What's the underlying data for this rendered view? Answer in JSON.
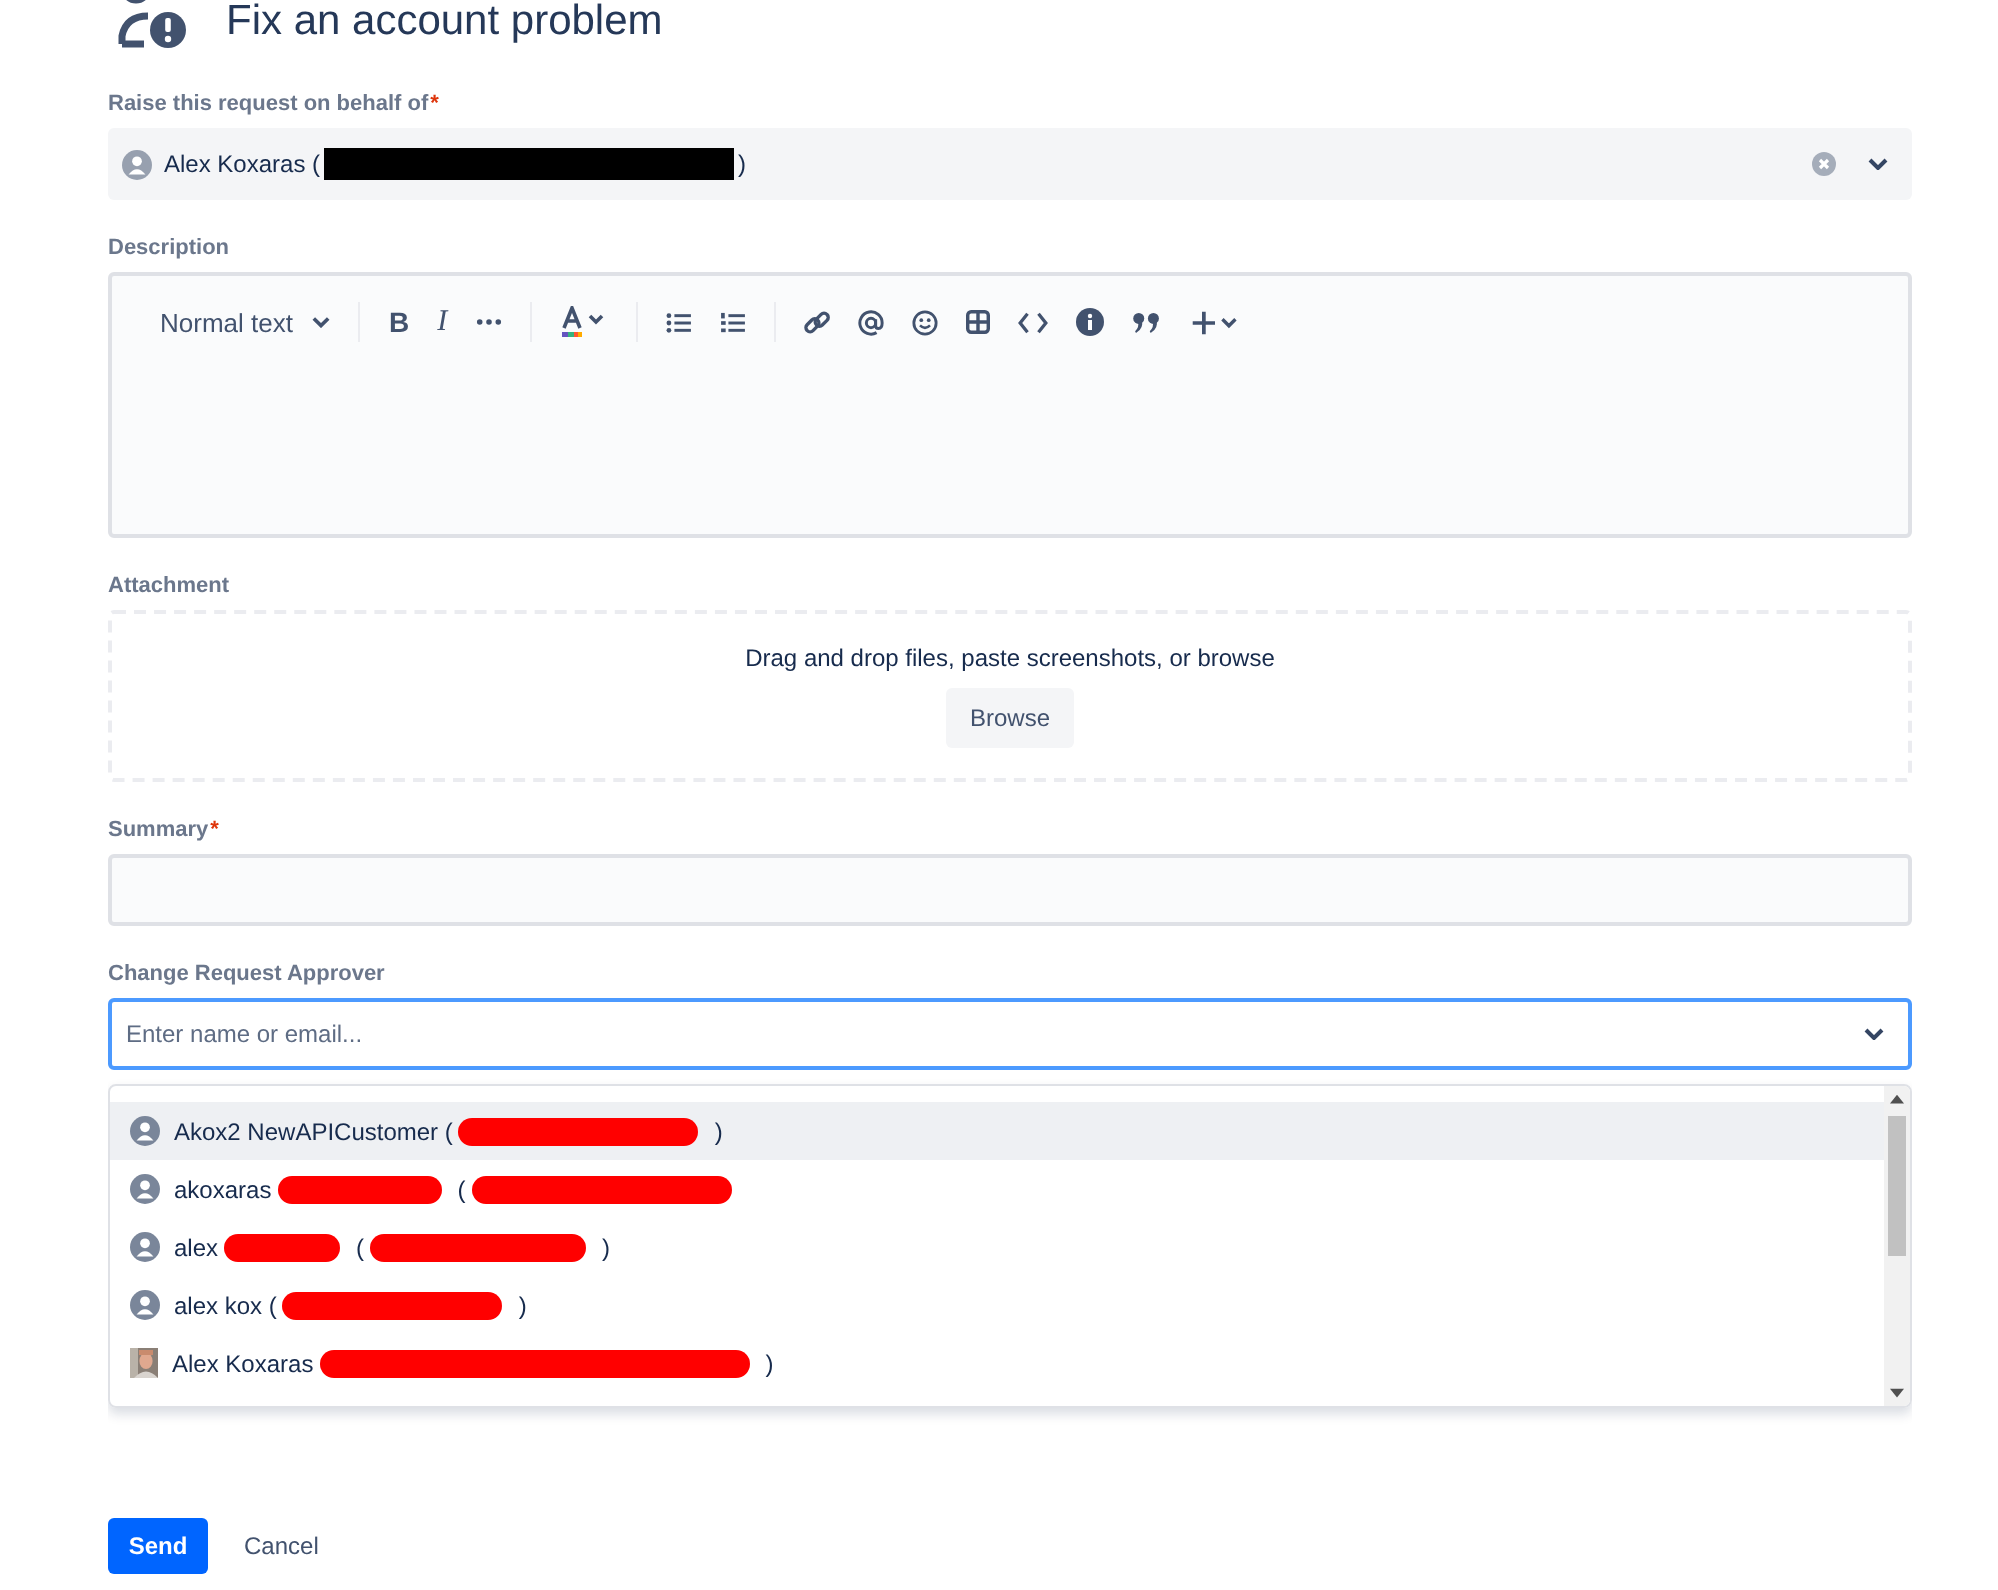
{
  "title": "Fix an account problem",
  "on_behalf": {
    "label": "Raise this request on behalf of",
    "required_mark": "*",
    "value_texts": [
      "Alex Koxaras (",
      ")"
    ]
  },
  "description": {
    "label": "Description",
    "toolbar": {
      "text_style": "Normal text",
      "bold": "B",
      "italic": "I"
    }
  },
  "attachment": {
    "label": "Attachment",
    "hint": "Drag and drop files, paste screenshots, or browse",
    "button": "Browse"
  },
  "summary": {
    "label": "Summary",
    "required_mark": "*"
  },
  "approver": {
    "label": "Change Request Approver",
    "placeholder": "Enter name or email...",
    "options": [
      {
        "texts": [
          "Akox2 NewAPICustomer (",
          ")"
        ],
        "kind": "person",
        "ends_redacted": false,
        "selected": true
      },
      {
        "texts": [
          "akoxaras",
          "("
        ],
        "kind": "person",
        "ends_redacted": true,
        "selected": false
      },
      {
        "texts": [
          "alex",
          "(",
          ")"
        ],
        "kind": "person",
        "ends_redacted": false,
        "selected": false
      },
      {
        "texts": [
          "alex kox (",
          ")"
        ],
        "kind": "person",
        "ends_redacted": false,
        "selected": false
      },
      {
        "texts": [
          "Alex Koxaras",
          ")"
        ],
        "ends_redacted": false,
        "selected": false
      }
    ]
  },
  "actions": {
    "primary": "Send",
    "secondary": "Cancel"
  }
}
